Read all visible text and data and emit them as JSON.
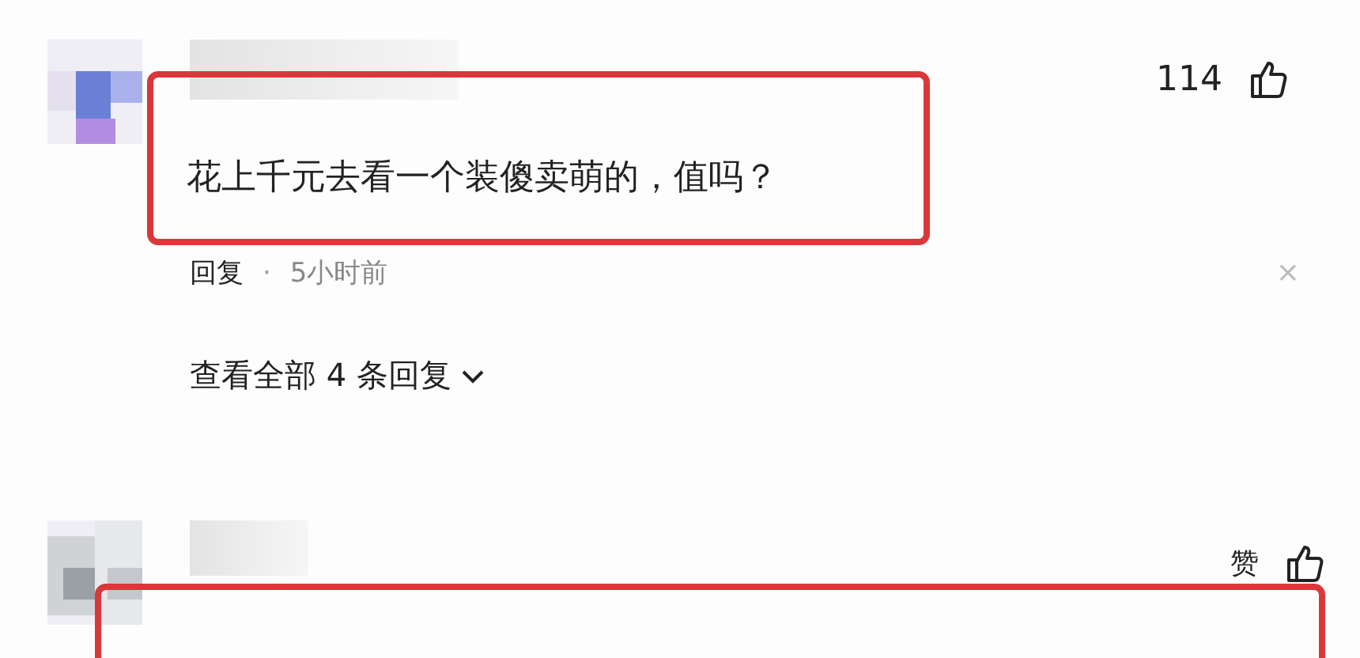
{
  "comments": [
    {
      "likes": "114",
      "highlighted": true,
      "text": "花上千元去看一个装傻卖萌的，值吗？",
      "reply_label": "回复",
      "separator": "·",
      "time": "5小时前",
      "close": "×",
      "view_replies": "查看全部 4 条回复"
    },
    {
      "likes": "赞",
      "highlighted": true
    }
  ]
}
